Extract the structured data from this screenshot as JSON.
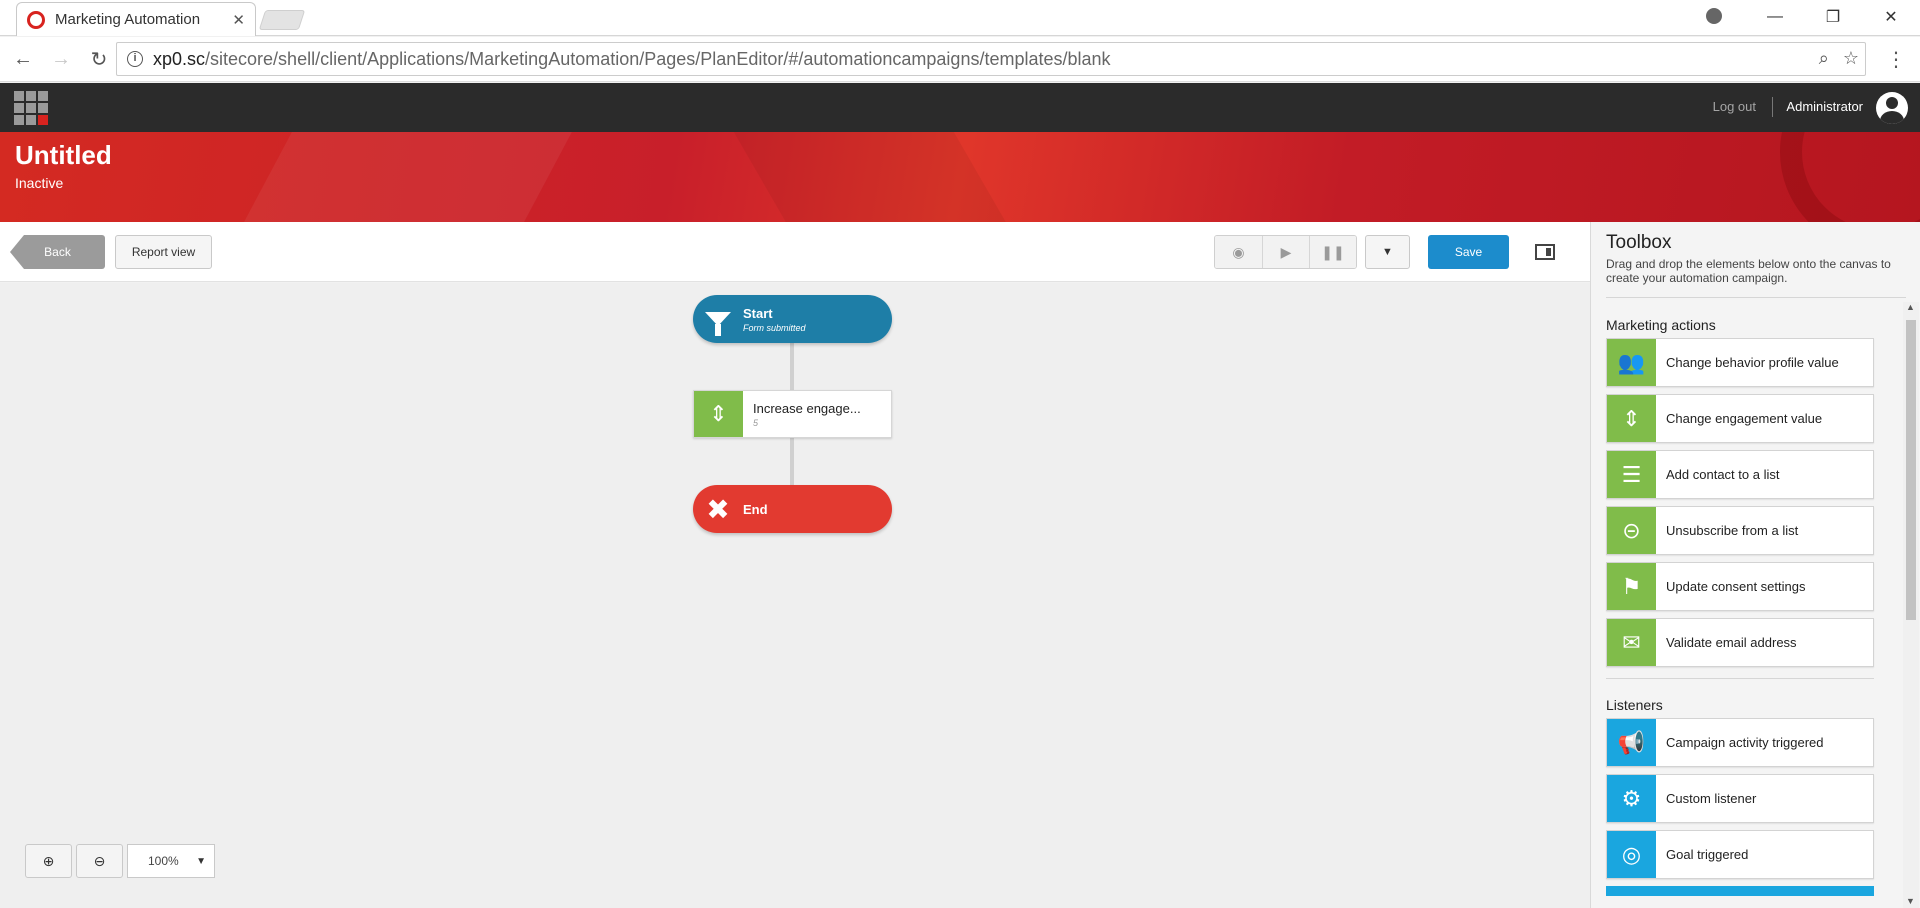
{
  "browser": {
    "tab_title": "Marketing Automation",
    "tab_close": "✕",
    "url_host": "xp0.sc",
    "url_path": "/sitecore/shell/client/Applications/MarketingAutomation/Pages/PlanEditor/#/automationcampaigns/templates/blank",
    "info_glyph": "i",
    "back_glyph": "←",
    "forward_glyph": "→",
    "reload_glyph": "↻",
    "zoom_glyph": "⌕",
    "star_glyph": "☆",
    "menu_glyph": "⋮",
    "minimize_glyph": "—",
    "restore_glyph": "❐",
    "close_glyph": "✕"
  },
  "app": {
    "logout_label": "Log out",
    "user_name": "Administrator"
  },
  "banner": {
    "title": "Untitled",
    "status": "Inactive"
  },
  "toolbar": {
    "back_label": "Back",
    "report_label": "Report view",
    "preview_glyph": "◉",
    "play_glyph": "▶",
    "pause_glyph": "❚❚",
    "dropdown_glyph": "▼",
    "save_label": "Save"
  },
  "canvas": {
    "start": {
      "title": "Start",
      "subtitle": "Form submitted"
    },
    "action": {
      "title": "Increase engage...",
      "subtitle": "5",
      "icon_glyph": "⇕"
    },
    "end": {
      "title": "End",
      "icon_glyph": "✖"
    },
    "zoom_in_glyph": "⊕",
    "zoom_out_glyph": "⊖",
    "zoom_level": "100%",
    "zoom_caret": "▼"
  },
  "toolbox": {
    "title": "Toolbox",
    "description": "Drag and drop the elements below onto the canvas to create your automation campaign.",
    "sections": [
      {
        "name": "Marketing actions",
        "items": [
          {
            "label": "Change behavior profile value",
            "icon": "people-icon",
            "glyph": "👥"
          },
          {
            "label": "Change engagement value",
            "icon": "updown-icon",
            "glyph": "⇕"
          },
          {
            "label": "Add contact to a list",
            "icon": "list-icon",
            "glyph": "☰"
          },
          {
            "label": "Unsubscribe from a list",
            "icon": "list-remove-icon",
            "glyph": "⊝"
          },
          {
            "label": "Update consent settings",
            "icon": "flag-icon",
            "glyph": "⚑"
          },
          {
            "label": "Validate email address",
            "icon": "email-icon",
            "glyph": "✉"
          }
        ]
      },
      {
        "name": "Listeners",
        "items": [
          {
            "label": "Campaign activity triggered",
            "icon": "megaphone-icon",
            "glyph": "📢"
          },
          {
            "label": "Custom listener",
            "icon": "gear-icon",
            "glyph": "⚙"
          },
          {
            "label": "Goal triggered",
            "icon": "target-icon",
            "glyph": "◎"
          }
        ]
      }
    ],
    "scroll_up": "▲",
    "scroll_down": "▼"
  }
}
